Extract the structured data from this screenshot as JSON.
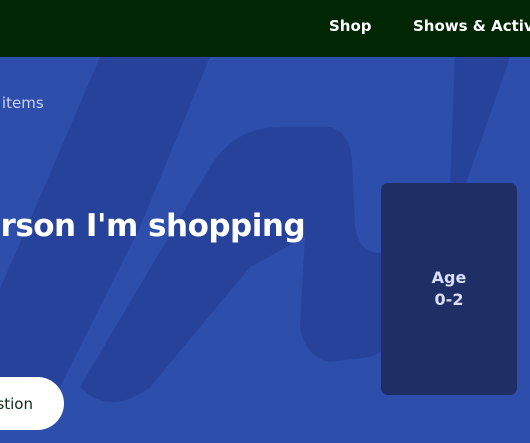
{
  "nav": {
    "items": [
      {
        "label": "Shop"
      },
      {
        "label": "Shows & Activiti"
      }
    ]
  },
  "hero": {
    "breadcrumb": "l items",
    "question_line1": "erson I'm shopping",
    "question_line2": ":",
    "cta_label": "stion"
  },
  "age_card": {
    "label": "Age",
    "range": "0-2"
  },
  "colors": {
    "nav_bg": "#002604",
    "hero_bg": "#2d4eaa",
    "deco_shape": "#27429a",
    "card_bg": "#1f2f65",
    "button_bg": "#ffffff"
  }
}
